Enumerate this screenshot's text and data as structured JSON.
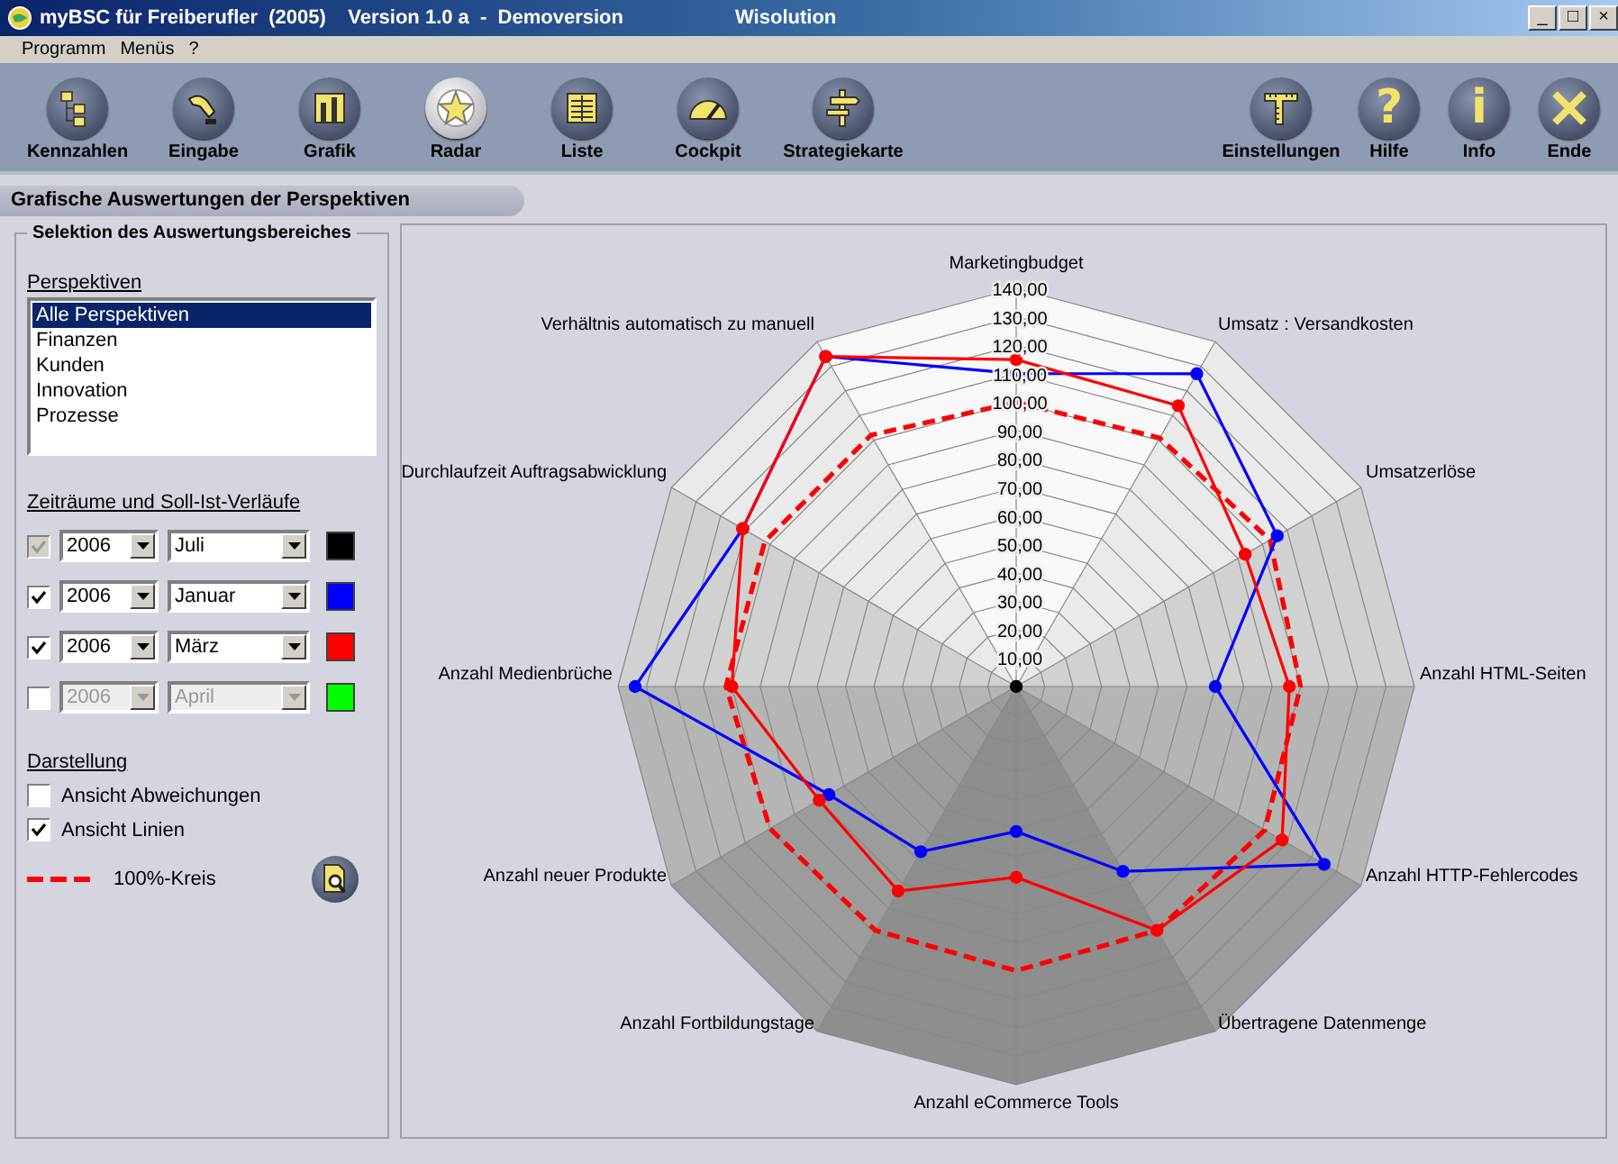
{
  "window": {
    "title": "myBSC für Freiberufler  (2005)    Version 1.0 a  -  Demoversion",
    "vendor": "Wisolution",
    "controls": [
      "_",
      "□",
      "×"
    ]
  },
  "menu": [
    "Programm",
    "Menüs",
    "?"
  ],
  "toolbar": {
    "left": [
      {
        "label": "Kennzahlen",
        "kind": "tree",
        "selected": false
      },
      {
        "label": "Eingabe",
        "kind": "hand",
        "selected": false
      },
      {
        "label": "Grafik",
        "kind": "bars",
        "selected": false
      },
      {
        "label": "Radar",
        "kind": "star",
        "selected": true
      },
      {
        "label": "Liste",
        "kind": "list",
        "selected": false
      },
      {
        "label": "Cockpit",
        "kind": "gauge",
        "selected": false
      },
      {
        "label": "Strategiekarte",
        "kind": "signpost",
        "selected": false
      }
    ],
    "right": [
      {
        "label": "Einstellungen",
        "kind": "ruler",
        "selected": false
      },
      {
        "label": "Hilfe",
        "kind": "glyph",
        "glyph": "?",
        "selected": false
      },
      {
        "label": "Info",
        "kind": "glyph",
        "glyph": "i",
        "selected": false
      },
      {
        "label": "Ende",
        "kind": "cross",
        "selected": false
      }
    ]
  },
  "section_title": "Grafische Auswertungen der Perspektiven",
  "selection": {
    "legend": "Selektion des Auswertungsbereiches",
    "perspectives": {
      "label": "Perspektiven",
      "items": [
        {
          "label": "Alle Perspektiven",
          "selected": true
        },
        {
          "label": "Finanzen",
          "selected": false
        },
        {
          "label": "Kunden",
          "selected": false
        },
        {
          "label": "Innovation",
          "selected": false
        },
        {
          "label": "Prozesse",
          "selected": false
        }
      ]
    },
    "periods": {
      "label": "Zeiträume und Soll-Ist-Verläufe",
      "rows": [
        {
          "checked": true,
          "checkbox_disabled": true,
          "year": "2006",
          "month": "Juli",
          "disabled": false,
          "color": "#000000"
        },
        {
          "checked": true,
          "checkbox_disabled": false,
          "year": "2006",
          "month": "Januar",
          "disabled": false,
          "color": "#0000ff"
        },
        {
          "checked": true,
          "checkbox_disabled": false,
          "year": "2006",
          "month": "März",
          "disabled": false,
          "color": "#ff0000"
        },
        {
          "checked": false,
          "checkbox_disabled": false,
          "year": "2006",
          "month": "April",
          "disabled": true,
          "color": "#00ff00"
        }
      ]
    },
    "display": {
      "label": "Darstellung",
      "options": [
        {
          "label": "Ansicht Abweichungen",
          "checked": false
        },
        {
          "label": "Ansicht Linien",
          "checked": true
        }
      ]
    },
    "circle_legend": {
      "label": "100%-Kreis",
      "color": "#ff0000"
    }
  },
  "radar": {
    "axes": [
      "Marketingbudget",
      "Verhältnis automatisch zu manuell",
      "Umsatz : Versandkosten",
      "Durchlaufzeit Auftragsabwicklung",
      "Umsatzerlöse",
      "Anzahl Medienbrüche",
      "Anzahl HTML-Seiten",
      "Anzahl neuer Produkte",
      "Anzahl HTTP-Fehlercodes",
      "Anzahl Fortbildungstage",
      "Übertragene Datenmenge",
      "Anzahl eCommerce Tools"
    ],
    "scale": [
      "140,00",
      "130,00",
      "120,00",
      "110,00",
      "100,00",
      "90,00",
      "80,00",
      "70,00",
      "60,00",
      "50,00",
      "40,00",
      "30,00",
      "20,00",
      "10,00"
    ],
    "series": [
      {
        "kind": "dashed",
        "color": "#ff0000"
      },
      {
        "kind": "solid",
        "color": "#000000"
      },
      {
        "kind": "solid",
        "color": "#0000ff"
      },
      {
        "kind": "solid",
        "color": "#ff0000"
      }
    ]
  }
}
